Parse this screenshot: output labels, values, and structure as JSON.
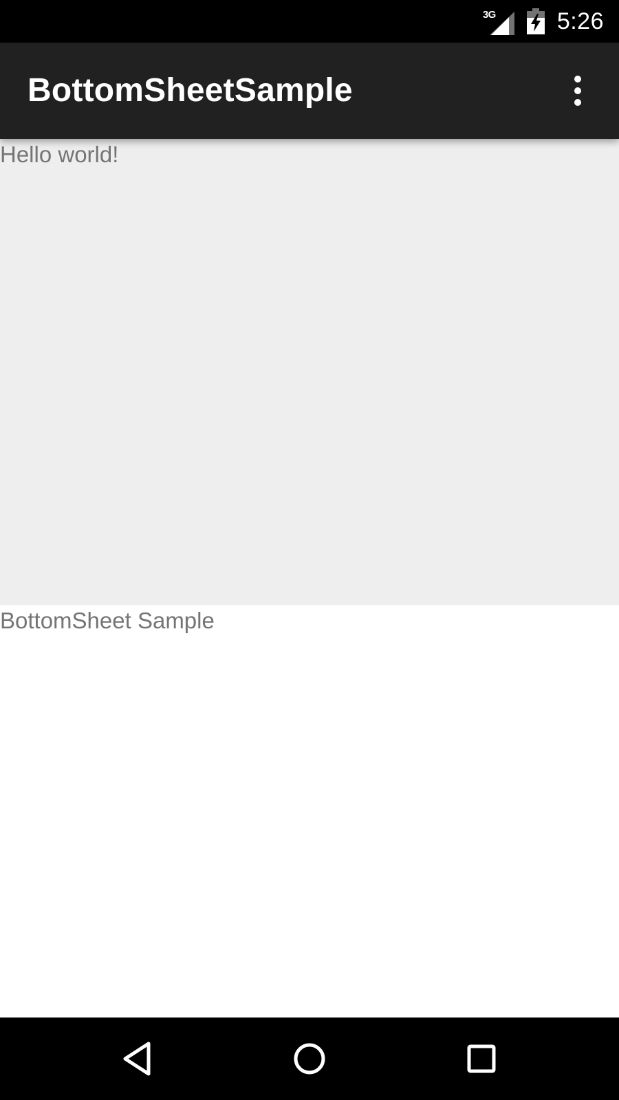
{
  "status_bar": {
    "network_label": "3G",
    "time": "5:26",
    "icons": [
      "signal-icon",
      "battery-charging-icon"
    ]
  },
  "app_bar": {
    "title": "BottomSheetSample",
    "overflow_icon": "more-vert-icon",
    "background_color": "#212121"
  },
  "main": {
    "text": "Hello world!",
    "background_color": "#eeeeee"
  },
  "bottom_sheet": {
    "text": "BottomSheet Sample",
    "background_color": "#ffffff"
  },
  "nav_bar": {
    "buttons": [
      "back-icon",
      "home-icon",
      "recents-icon"
    ]
  }
}
